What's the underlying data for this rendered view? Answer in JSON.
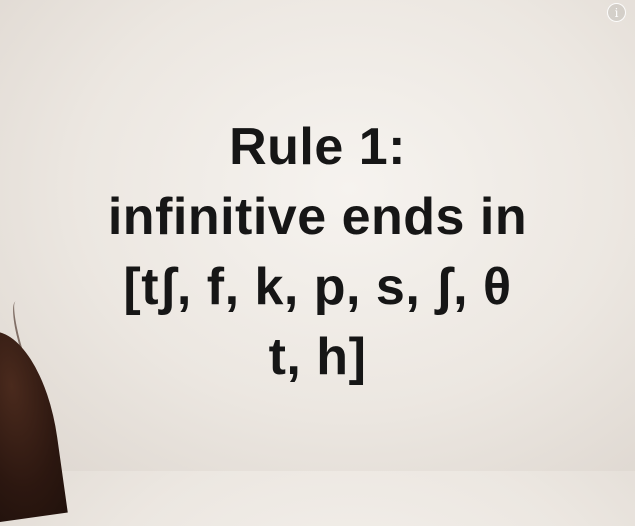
{
  "video": {
    "info_icon": "info-icon",
    "info_glyph": "i"
  },
  "slide": {
    "lines": [
      "Rule 1:",
      "infinitive ends in",
      "[tʃ, f, k, p, s, ʃ, θ",
      "t, h]"
    ]
  },
  "colors": {
    "background": "#ece7e1",
    "text": "#161616",
    "overlay_icon": "#ffffff"
  }
}
